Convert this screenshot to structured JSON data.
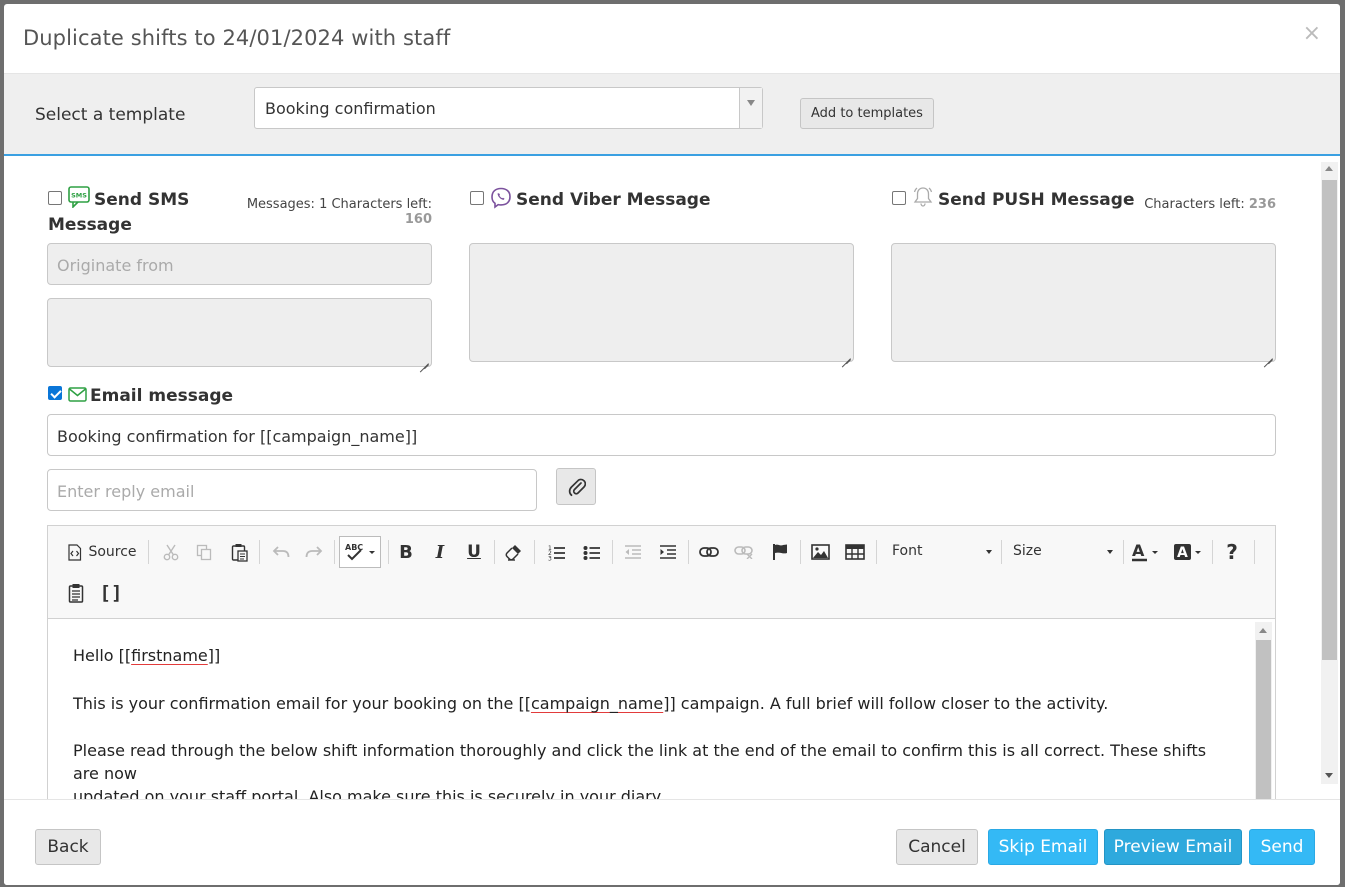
{
  "dialog": {
    "title": "Duplicate shifts to 24/01/2024 with staff",
    "close_glyph": "×"
  },
  "template_bar": {
    "label": "Select a template",
    "selected": "Booking confirmation",
    "add_button": "Add to templates"
  },
  "sms": {
    "label_line1": "Send SMS",
    "label_line2": "Message",
    "checked": false,
    "counter_text": "Messages: 1 Characters left:",
    "counter_value": "160",
    "originate_placeholder": "Originate from",
    "icon": "sms-icon",
    "icon_text": "SMS"
  },
  "viber": {
    "label": "Send Viber Message",
    "checked": false,
    "icon": "viber-icon"
  },
  "push": {
    "label": "Send PUSH Message",
    "checked": false,
    "counter_text": "Characters left:",
    "counter_value": "236",
    "icon": "bell-icon"
  },
  "email": {
    "label": "Email message",
    "checked": true,
    "subject": "Booking confirmation for [[campaign_name]]",
    "reply_placeholder": "Enter reply email",
    "icon": "envelope-icon"
  },
  "editor": {
    "toolbar": {
      "source": "Source",
      "font": "Font",
      "size": "Size"
    },
    "body": {
      "p1_pre": "Hello [[",
      "p1_word": "firstname",
      "p1_post": "]]",
      "p2_pre": "This is your confirmation email for your booking on the [[",
      "p2_word": "campaign_name",
      "p2_post": "]] campaign. A full brief will follow closer to the activity.",
      "p3_line1": "Please read through the below shift information thoroughly and click the link at the end of the email to confirm this is all correct. These shifts are now",
      "p3_line2": "updated on your staff portal. Also make sure this is securely in your diary."
    }
  },
  "footer": {
    "back": "Back",
    "cancel": "Cancel",
    "skip_email": "Skip Email",
    "preview_email": "Preview Email",
    "send": "Send"
  },
  "colors": {
    "accent_blue": "#34b9f5",
    "sms_green": "#2ea043",
    "viber_purple": "#7b519d",
    "email_green": "#2ea043"
  }
}
